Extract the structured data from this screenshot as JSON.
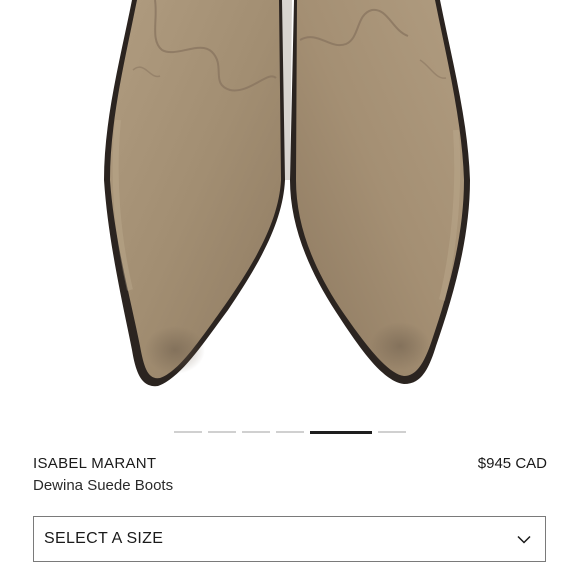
{
  "product": {
    "brand": "ISABEL MARANT",
    "name": "Dewina Suede Boots",
    "price": "$945 CAD"
  },
  "gallery": {
    "image_count": 6,
    "active_index": 4,
    "image_subject": "tan-suede-pointed-toe-boots"
  },
  "size_selector": {
    "label": "SELECT A SIZE",
    "icon": "chevron-down-icon"
  },
  "colors": {
    "suede": "#a89478",
    "sole_edge": "#2b2420",
    "text": "#1a1a1a",
    "border": "#7a7a7a"
  }
}
